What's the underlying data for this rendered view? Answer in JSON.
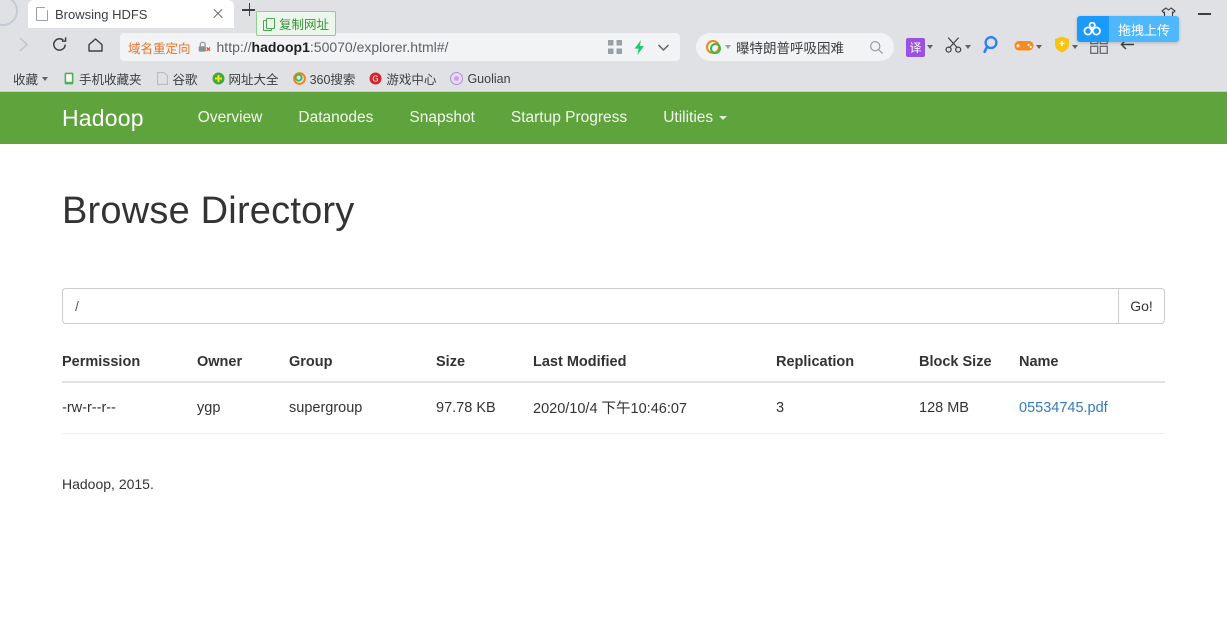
{
  "browser": {
    "tab": {
      "title": "Browsing HDFS",
      "close_label": "×"
    },
    "newtab_label": "+",
    "copy_url_tooltip": "复制网址",
    "drag_upload_tooltip": "拖拽上传",
    "window": {
      "skin_icon": "tshirt-icon",
      "minimize_label": "—"
    },
    "nav": {
      "forward_icon": "chevron-right-icon",
      "reload_icon": "reload-icon",
      "home_icon": "home-icon"
    },
    "omnibox": {
      "redirect_tag": "域名重定向",
      "security_icon": "lock-crossed-icon",
      "url_prefix": "http://",
      "url_host": "hadoop1",
      "url_suffix": ":50070/explorer.html#/",
      "qr_icon": "qrcode-icon",
      "bolt_icon": "lightning-bolt-icon",
      "chevron_icon": "chevron-down-icon"
    },
    "search": {
      "engine_icon": "360-logo-icon",
      "query": "曝特朗普呼吸困难",
      "search_icon": "search-icon"
    },
    "toolbar_icons": [
      {
        "name": "translate-button",
        "label": "译"
      },
      {
        "name": "scissors-icon",
        "label": ""
      },
      {
        "name": "magnifier-icon",
        "label": ""
      },
      {
        "name": "gamepad-icon",
        "label": ""
      },
      {
        "name": "shield-icon",
        "label": ""
      },
      {
        "name": "apps-grid-icon",
        "label": ""
      },
      {
        "name": "collapse-arrow-icon",
        "label": ""
      }
    ],
    "bookmarks": [
      {
        "label": "收藏",
        "icon": "folder-icon",
        "caret": true
      },
      {
        "label": "手机收藏夹",
        "icon": "phone-icon",
        "caret": false
      },
      {
        "label": "谷歌",
        "icon": "page-icon",
        "caret": false
      },
      {
        "label": "网址大全",
        "icon": "green-plus-icon",
        "caret": false
      },
      {
        "label": "360搜索",
        "icon": "360-logo-icon",
        "caret": false
      },
      {
        "label": "游戏中心",
        "icon": "red-g-icon",
        "caret": false
      },
      {
        "label": "Guolian",
        "icon": "purple-circle-icon",
        "caret": false
      }
    ]
  },
  "hadoop": {
    "brand": "Hadoop",
    "nav_items": [
      {
        "label": "Overview",
        "caret": false
      },
      {
        "label": "Datanodes",
        "caret": false
      },
      {
        "label": "Snapshot",
        "caret": false
      },
      {
        "label": "Startup Progress",
        "caret": false
      },
      {
        "label": "Utilities",
        "caret": true
      }
    ],
    "page_title": "Browse Directory",
    "path_value": "/",
    "path_placeholder": "/",
    "go_label": "Go!",
    "table": {
      "headers": [
        "Permission",
        "Owner",
        "Group",
        "Size",
        "Last Modified",
        "Replication",
        "Block Size",
        "Name"
      ],
      "rows": [
        {
          "permission": "-rw-r--r--",
          "owner": "ygp",
          "group": "supergroup",
          "size": "97.78 KB",
          "last_modified": "2020/10/4 下午10:46:07",
          "replication": "3",
          "block_size": "128 MB",
          "name": "05534745.pdf"
        }
      ]
    },
    "footer": "Hadoop, 2015."
  },
  "colors": {
    "navbar_green": "#5fa33c",
    "link_blue": "#337ab7",
    "redirect_orange": "#e8732b",
    "tooltip_blue": "#4fb8fd",
    "tooltip_green": "#eaf7ea"
  }
}
